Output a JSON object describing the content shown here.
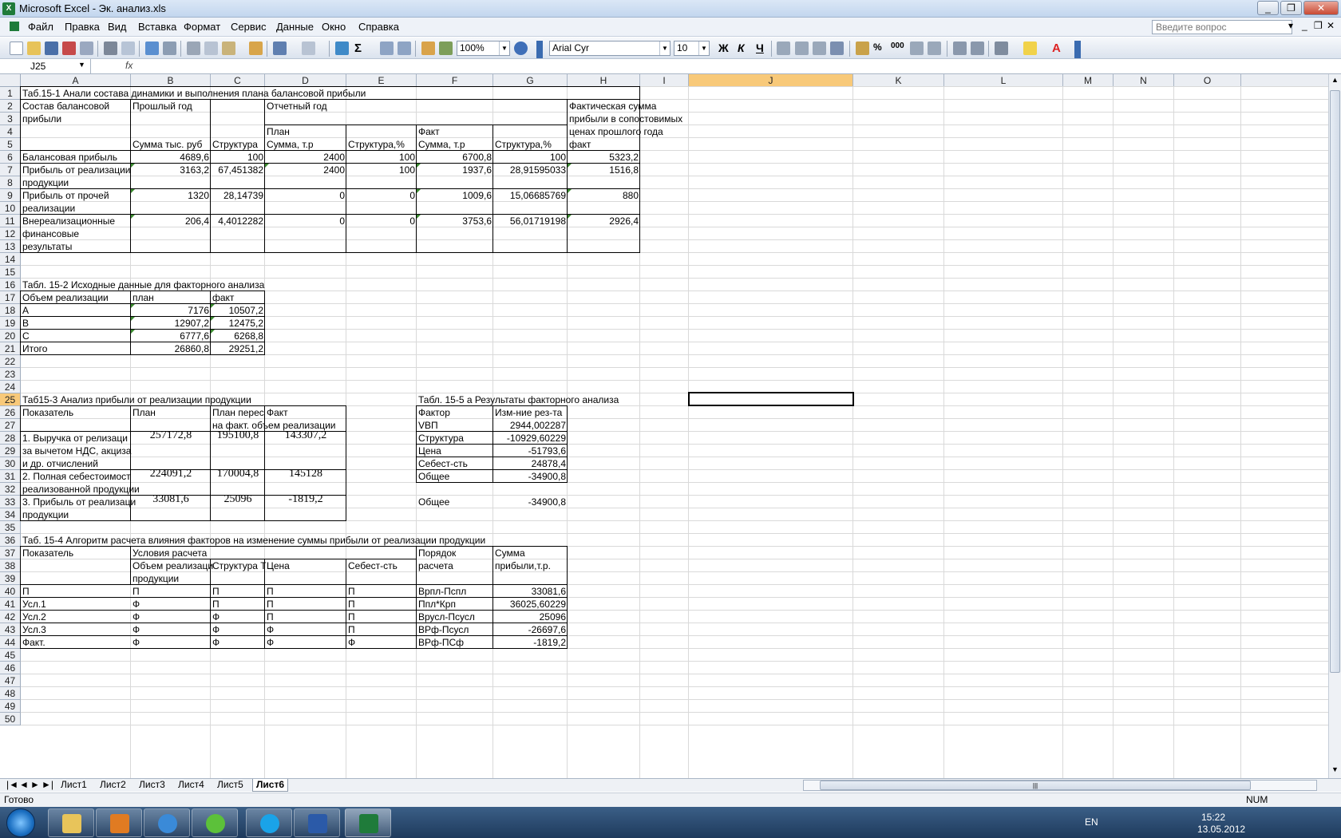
{
  "window": {
    "title": "Microsoft Excel - Эк. анализ.xls",
    "min": "_",
    "restore": "❐",
    "close": "✕"
  },
  "menu": [
    "Файл",
    "Правка",
    "Вид",
    "Вставка",
    "Формат",
    "Сервис",
    "Данные",
    "Окно",
    "Справка"
  ],
  "help_placeholder": "Введите вопрос",
  "toolbar": {
    "zoom": "100%",
    "font": "Arial Cyr",
    "size": "10",
    "bold": "Ж",
    "italic": "К",
    "underline": "Ч"
  },
  "namebox": "J25",
  "fx": "fx",
  "columns": [
    "A",
    "B",
    "C",
    "D",
    "E",
    "F",
    "G",
    "H",
    "I",
    "J",
    "K",
    "L",
    "M",
    "N",
    "O"
  ],
  "rows": [
    "1",
    "2",
    "3",
    "4",
    "5",
    "6",
    "7",
    "8",
    "9",
    "10",
    "11",
    "12",
    "13",
    "14",
    "15",
    "16",
    "17",
    "18",
    "19",
    "20",
    "21",
    "22",
    "23",
    "24",
    "25",
    "26",
    "27",
    "28",
    "29",
    "30",
    "31",
    "32",
    "33",
    "34",
    "35",
    "36",
    "37",
    "38",
    "39",
    "40",
    "41",
    "42",
    "43",
    "44",
    "45",
    "46",
    "47",
    "48",
    "49",
    "50"
  ],
  "cells": {
    "a1": "Таб.15-1 Анали состава динамики и выполнения плана балансовой прибыли",
    "a2": "Состав балансовой",
    "b2": "Прошлый год",
    "d2": "Отчетный год",
    "h2": "Фактическая сумма",
    "a3": "прибыли",
    "h3": "прибыли в сопостовимых",
    "d4": "План",
    "f4": "Факт",
    "h4": "ценах прошлого года",
    "b5": "Сумма тыс. руб",
    "c5": "Структура",
    "d5": "Сумма, т.р",
    "e5": "Структура,%",
    "f5": "Сумма, т.р",
    "g5": "Структура,%",
    "h5": "факт",
    "a6": "Балансовая прибыль",
    "b6": "4689,6",
    "c6": "100",
    "d6": "2400",
    "e6": "100",
    "f6": "6700,8",
    "g6": "100",
    "h6": "5323,2",
    "a7": "Прибыль от реализации",
    "b7": "3163,2",
    "c7": "67,451382",
    "d7": "2400",
    "e7": "100",
    "f7": "1937,6",
    "g7": "28,91595033",
    "h7": "1516,8",
    "a8": "продукции",
    "a9": "Прибыль от прочей",
    "b9": "1320",
    "c9": "28,14739",
    "d9": "0",
    "e9": "0",
    "f9": "1009,6",
    "g9": "15,06685769",
    "h9": "880",
    "a10": "реализации",
    "a11": "Внереализационные",
    "b11": "206,4",
    "c11": "4,4012282",
    "d11": "0",
    "e11": "0",
    "f11": "3753,6",
    "g11": "56,01719198",
    "h11": "2926,4",
    "a12": "финансовые",
    "a13": "результаты",
    "a16": "Табл. 15-2 Исходные данные для факторного анализа",
    "a17": "Объем реализации",
    "b17": "план",
    "c17": "факт",
    "a18": "А",
    "b18": "7176",
    "c18": "10507,2",
    "a19": "В",
    "b19": "12907,2",
    "c19": "12475,2",
    "a20": "С",
    "b20": "6777,6",
    "c20": "6268,8",
    "a21": "Итого",
    "b21": "26860,8",
    "c21": "29251,2",
    "a25": "Таб15-3 Анализ прибыли от реализации продукции",
    "f25": "Табл. 15-5 а Результаты факторного анализа",
    "a26": "Показатель",
    "b26": "План",
    "c26": "План перес",
    "d26": "Факт",
    "f26": "Фактор",
    "g26": "Изм-ние рез-та",
    "c27": "на факт. объем реализации",
    "f27": "VВП",
    "g27": "2944,002287",
    "a28": "1. Выручка от релизаци",
    "b28": "257172,8",
    "c28": "195100,8",
    "d28": "143307,2",
    "f28": "Структура",
    "g28": "-10929,60229",
    "a29": "за вычетом НДС, акциза",
    "f29": "Цена",
    "g29": "-51793,6",
    "a30": "и др. отчислений",
    "f30": "Себест-сть",
    "g30": "24878,4",
    "a31": "2. Полная себестоимост",
    "b31": "224091,2",
    "c31": "170004,8",
    "d31": "145128",
    "f31": "Общее",
    "g31": "-34900,8",
    "a32": "реализованной продукции",
    "a33": "3. Прибыль от реализаци",
    "b33": "33081,6",
    "c33": "25096",
    "d33": "-1819,2",
    "f33": "Общее",
    "g33": "-34900,8",
    "a34": "продукции",
    "a36": "Таб. 15-4 Алгоритм расчета влияния факторов на изменение суммы прибыли от реализации продукции",
    "a37": "Показатель",
    "b37": "Условия расчета",
    "f37": "Порядок",
    "g37": "Сумма",
    "b38": "Объем реализаци",
    "c38": "Структура Т",
    "d38": "Цена",
    "e38": "Себест-сть",
    "f38": "расчета",
    "g38": "прибыли,т.р.",
    "b39": "продукции",
    "a40": "П",
    "b40": "П",
    "c40": "П",
    "d40": "П",
    "e40": "П",
    "f40": "Врпл-Пспл",
    "g40": "33081,6",
    "a41": "Усл.1",
    "b41": "Ф",
    "c41": "П",
    "d41": "П",
    "e41": "П",
    "f41": "Ппл*Крп",
    "g41": "36025,60229",
    "a42": "Усл.2",
    "b42": "Ф",
    "c42": "Ф",
    "d42": "П",
    "e42": "П",
    "f42": "Врусл-Псусл",
    "g42": "25096",
    "a43": "Усл.3",
    "b43": "Ф",
    "c43": "Ф",
    "d43": "Ф",
    "e43": "П",
    "f43": "ВРф-Псусл",
    "g43": "-26697,6",
    "a44": "Факт.",
    "b44": "Ф",
    "c44": "Ф",
    "d44": "Ф",
    "e44": "Ф",
    "f44": "ВРф-ПСф",
    "g44": "-1819,2"
  },
  "sheets": [
    "Лист1",
    "Лист2",
    "Лист3",
    "Лист4",
    "Лист5",
    "Лист6"
  ],
  "active_sheet": "Лист6",
  "status": {
    "ready": "Готово",
    "num": "NUM"
  },
  "tray": {
    "lang": "EN",
    "time": "15:22",
    "date": "13.05.2012"
  },
  "colors": {
    "accent": "#f8c979",
    "grid": "#d9d9d9",
    "header": "#ebeef3"
  }
}
